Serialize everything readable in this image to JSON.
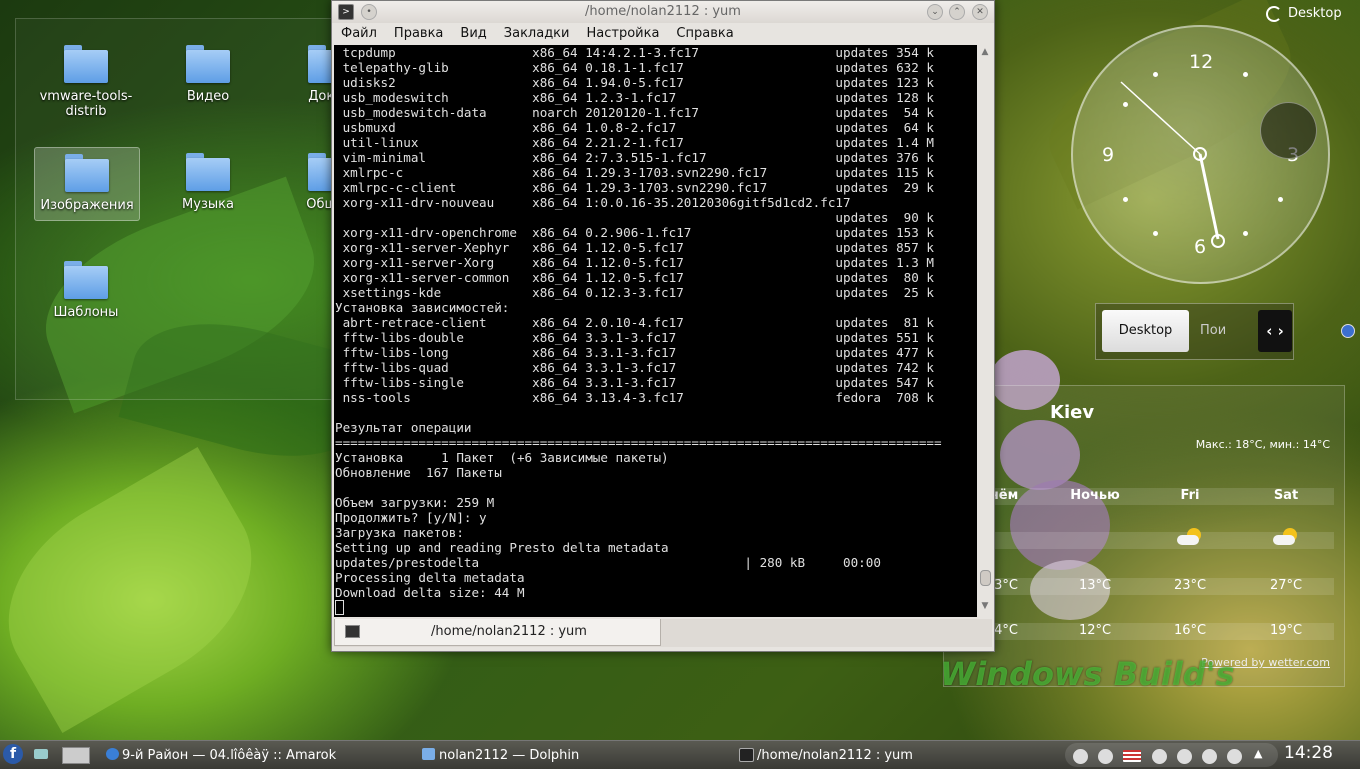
{
  "desktop_folders": [
    {
      "label": "vmware-tools-distrib"
    },
    {
      "label": "Видео"
    },
    {
      "label": "Докум"
    },
    {
      "label": "Изображения"
    },
    {
      "label": "Музыка"
    },
    {
      "label": "Общед"
    },
    {
      "label": "Шаблоны"
    }
  ],
  "terminal": {
    "title": "/home/nolan2112 : yum",
    "menu": [
      "Файл",
      "Правка",
      "Вид",
      "Закладки",
      "Настройка",
      "Справка"
    ],
    "tab_label": "/home/nolan2112 : yum",
    "lines": [
      " tcpdump                  x86_64 14:4.2.1-3.fc17                  updates 354 k",
      " telepathy-glib           x86_64 0.18.1-1.fc17                    updates 632 k",
      " udisks2                  x86_64 1.94.0-5.fc17                    updates 123 k",
      " usb_modeswitch           x86_64 1.2.3-1.fc17                     updates 128 k",
      " usb_modeswitch-data      noarch 20120120-1.fc17                  updates  54 k",
      " usbmuxd                  x86_64 1.0.8-2.fc17                     updates  64 k",
      " util-linux               x86_64 2.21.2-1.fc17                    updates 1.4 M",
      " vim-minimal              x86_64 2:7.3.515-1.fc17                 updates 376 k",
      " xmlrpc-c                 x86_64 1.29.3-1703.svn2290.fc17         updates 115 k",
      " xmlrpc-c-client          x86_64 1.29.3-1703.svn2290.fc17         updates  29 k",
      " xorg-x11-drv-nouveau     x86_64 1:0.0.16-35.20120306gitf5d1cd2.fc17",
      "                                                                  updates  90 k",
      " xorg-x11-drv-openchrome  x86_64 0.2.906-1.fc17                   updates 153 k",
      " xorg-x11-server-Xephyr   x86_64 1.12.0-5.fc17                    updates 857 k",
      " xorg-x11-server-Xorg     x86_64 1.12.0-5.fc17                    updates 1.3 M",
      " xorg-x11-server-common   x86_64 1.12.0-5.fc17                    updates  80 k",
      " xsettings-kde            x86_64 0.12.3-3.fc17                    updates  25 k",
      "Установка зависимостей:",
      " abrt-retrace-client      x86_64 2.0.10-4.fc17                    updates  81 k",
      " fftw-libs-double         x86_64 3.3.1-3.fc17                     updates 551 k",
      " fftw-libs-long           x86_64 3.3.1-3.fc17                     updates 477 k",
      " fftw-libs-quad           x86_64 3.3.1-3.fc17                     updates 742 k",
      " fftw-libs-single         x86_64 3.3.1-3.fc17                     updates 547 k",
      " nss-tools                x86_64 3.13.4-3.fc17                    fedora  708 k",
      "",
      "Результат операции",
      "================================================================================",
      "Установка     1 Пакет  (+6 Зависимые пакеты)",
      "Обновление  167 Пакеты",
      "",
      "Объем загрузки: 259 M",
      "Продолжить? [y/N]: y",
      "Загрузка пакетов:",
      "Setting up and reading Presto delta metadata",
      "updates/prestodelta                                   | 280 kB     00:00",
      "Processing delta metadata",
      "Download delta size: 44 M"
    ]
  },
  "toolbox": {
    "label": "Desktop"
  },
  "clock_numbers": {
    "n12": "12",
    "n3": "3",
    "n6": "6",
    "n9": "9"
  },
  "pager": {
    "desktop": "Desktop",
    "search": "Пои",
    "nav": "‹ ›"
  },
  "weather": {
    "city": "Kiev",
    "minmax": "Макс.: 18°C, мин.: 14°C",
    "days": [
      "нём",
      "Ночью",
      "Fri",
      "Sat"
    ],
    "highs": [
      "3°C",
      "13°C",
      "23°C",
      "27°C"
    ],
    "lows": [
      "4°C",
      "12°C",
      "16°C",
      "19°C"
    ],
    "powered": "Powered by wetter.com"
  },
  "watermark": "Windows Build's",
  "taskbar": {
    "tasks": [
      {
        "label": "9-й Район — 04.lîôêàÿ  ::  Amarok",
        "icon_color": "#3a7fd6"
      },
      {
        "label": "nolan2112 — Dolphin",
        "icon_color": "#7aaee8"
      },
      {
        "label": "/home/nolan2112 : yum",
        "icon_color": "#222222"
      }
    ],
    "time": "14:28"
  }
}
